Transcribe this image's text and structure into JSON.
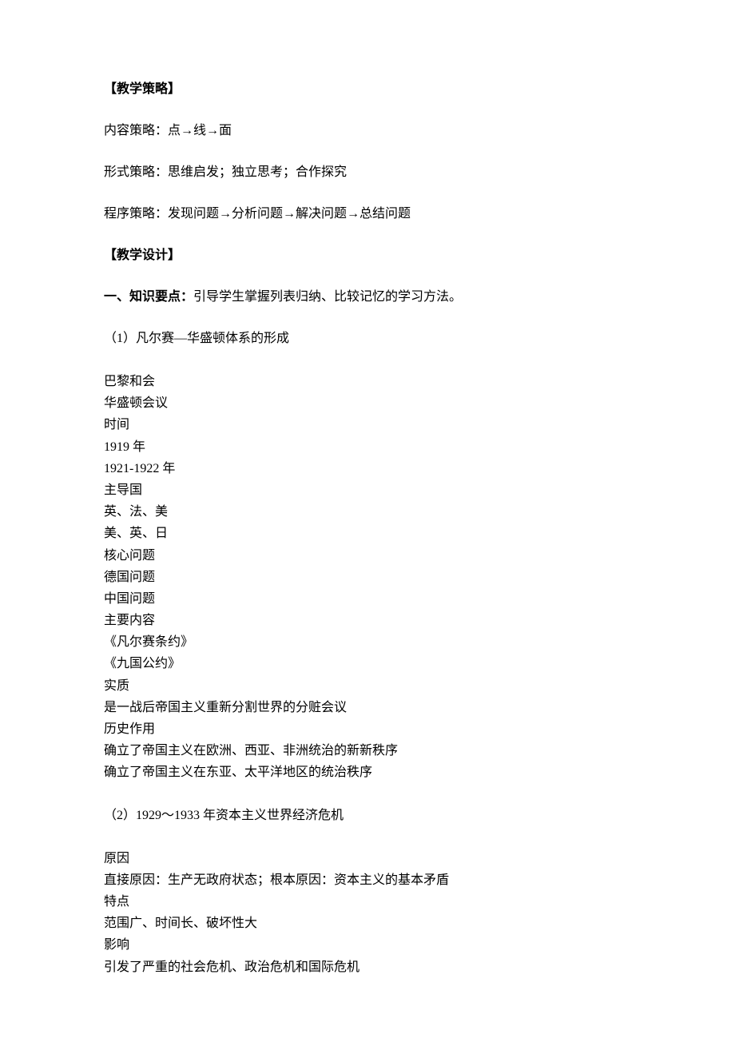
{
  "section1": {
    "title": "【教学策略】",
    "p1": "内容策略：点→线→面",
    "p2": "形式策略：思维启发；独立思考；合作探究",
    "p3": "程序策略：发现问题→分析问题→解决问题→总结问题"
  },
  "section2": {
    "title": "【教学设计】",
    "line1_bold": "一、知识要点：",
    "line1_rest": "引导学生掌握列表归纳、比较记忆的学习方法。",
    "sub1_title": "（1）凡尔赛—华盛顿体系的形成",
    "list1": [
      "巴黎和会",
      "华盛顿会议",
      "时间",
      "1919 年",
      "1921-1922 年",
      "主导国",
      "英、法、美",
      "美、英、日",
      "核心问题",
      "德国问题",
      "中国问题",
      "主要内容",
      "《凡尔赛条约》",
      "《九国公约》",
      "实质",
      "是一战后帝国主义重新分割世界的分赃会议",
      "历史作用",
      "确立了帝国主义在欧洲、西亚、非洲统治的新新秩序",
      "确立了帝国主义在东亚、太平洋地区的统治秩序"
    ],
    "sub2_title": "（2）1929～1933 年资本主义世界经济危机",
    "list2": [
      "原因",
      "直接原因：生产无政府状态；根本原因：资本主义的基本矛盾",
      "特点",
      "范围广、时间长、破坏性大",
      "影响",
      "引发了严重的社会危机、政治危机和国际危机"
    ]
  }
}
